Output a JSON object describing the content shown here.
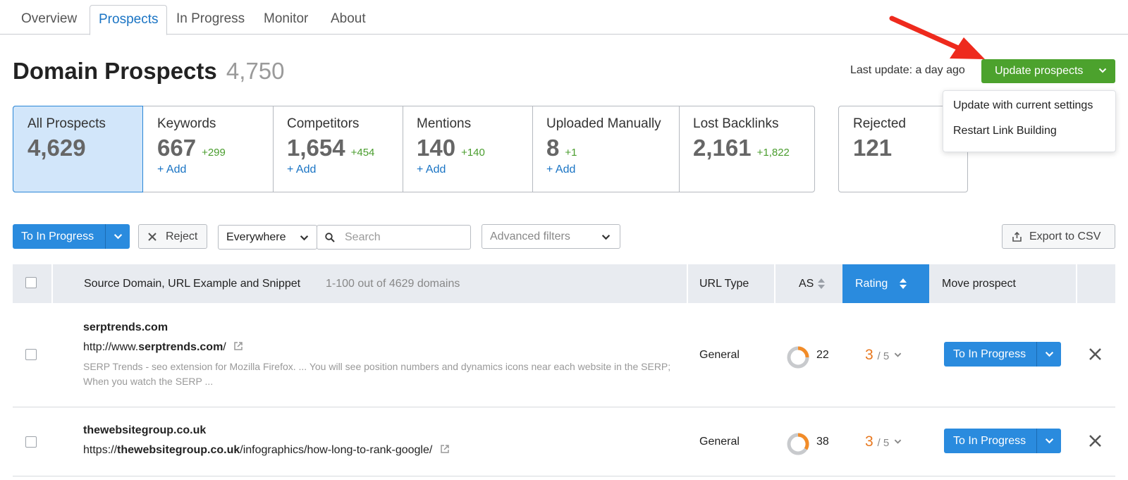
{
  "tabs": [
    "Overview",
    "Prospects",
    "In Progress",
    "Monitor",
    "About"
  ],
  "header": {
    "title": "Domain Prospects",
    "count": "4,750",
    "last_update": "Last update: a day ago",
    "update_button": "Update prospects"
  },
  "update_menu": [
    "Update with current settings",
    "Restart Link Building"
  ],
  "cards": [
    {
      "label": "All Prospects",
      "value": "4,629",
      "delta": "",
      "add": ""
    },
    {
      "label": "Keywords",
      "value": "667",
      "delta": "+299",
      "add": "+ Add"
    },
    {
      "label": "Competitors",
      "value": "1,654",
      "delta": "+454",
      "add": "+ Add"
    },
    {
      "label": "Mentions",
      "value": "140",
      "delta": "+140",
      "add": "+ Add"
    },
    {
      "label": "Uploaded Manually",
      "value": "8",
      "delta": "+1",
      "add": "+ Add"
    },
    {
      "label": "Lost Backlinks",
      "value": "2,161",
      "delta": "+1,822",
      "add": ""
    }
  ],
  "rejected": {
    "label": "Rejected",
    "value": "121"
  },
  "toolbar": {
    "to_in_progress": "To In Progress",
    "reject": "Reject",
    "scope": "Everywhere",
    "search_placeholder": "Search",
    "advanced_filters": "Advanced filters",
    "export": "Export to CSV"
  },
  "table": {
    "col_source": "Source Domain, URL Example and Snippet",
    "range": "1-100 out of 4629 domains",
    "col_url_type": "URL Type",
    "col_as": "AS",
    "col_rating": "Rating",
    "col_move": "Move prospect",
    "rows": [
      {
        "domain": "serptrends.com",
        "url_prefix": "http://www.",
        "url_domain": "serptrends.com",
        "url_suffix": "/",
        "snippet": "SERP Trends - seo extension for Mozilla Firefox. ... You will see position numbers and dynamics icons near each website in the SERP; When you watch the SERP ...",
        "url_type": "General",
        "as": "22",
        "rating": "3",
        "rating_max": "/ 5",
        "move": "To In Progress"
      },
      {
        "domain": "thewebsitegroup.co.uk",
        "url_prefix": "https://",
        "url_domain": "thewebsitegroup.co.uk",
        "url_suffix": "/infographics/how-long-to-rank-google/",
        "snippet": "",
        "url_type": "General",
        "as": "38",
        "rating": "3",
        "rating_max": "/ 5",
        "move": "To In Progress"
      }
    ]
  },
  "colors": {
    "accent_blue": "#2a8bde",
    "green": "#4ca22d",
    "orange": "#e8781f",
    "arrow_red": "#ee2a1d"
  }
}
